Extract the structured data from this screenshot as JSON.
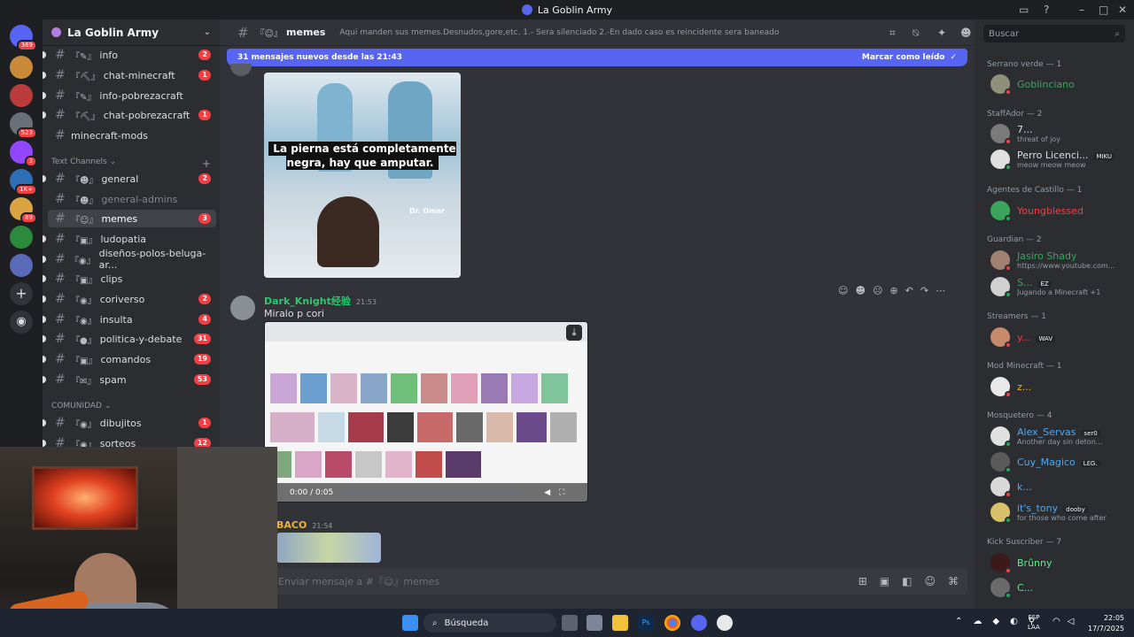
{
  "window": {
    "title": "La Goblin Army"
  },
  "servers": [
    {
      "badge": "369",
      "color": "#2b2d31"
    },
    {
      "badge": "",
      "color": "#c98b3a"
    },
    {
      "badge": "",
      "color": "#b93b3b"
    },
    {
      "badge": "523",
      "color": "#6b7078"
    },
    {
      "badge": "3",
      "color": "#9146ff"
    },
    {
      "badge": "1K+",
      "color": "#2f6fb5"
    },
    {
      "badge": "89",
      "color": "#d9a441"
    },
    {
      "badge": "",
      "color": "#2c8a3c"
    },
    {
      "badge": "",
      "color": "#5b6ab8"
    }
  ],
  "guild": {
    "name": "La Goblin Army"
  },
  "channels_top": [
    {
      "prefix": "『✎』",
      "name": "info",
      "count": "2"
    },
    {
      "prefix": "『⛏』",
      "name": "chat-minecraft",
      "count": "1"
    },
    {
      "prefix": "『✎』",
      "name": "info-pobrezacraft",
      "count": ""
    },
    {
      "prefix": "『⛏』",
      "name": "chat-pobrezacraft",
      "count": "1"
    },
    {
      "prefix": "",
      "name": "minecraft-mods",
      "count": ""
    }
  ],
  "category_text": "Text Channels",
  "channels_text": [
    {
      "prefix": "『☻』",
      "name": "general",
      "count": "2"
    },
    {
      "prefix": "『☻』",
      "name": "general-admins",
      "count": ""
    },
    {
      "prefix": "『☺』",
      "name": "memes",
      "count": "3"
    },
    {
      "prefix": "『▣』",
      "name": "ludopatia",
      "count": ""
    },
    {
      "prefix": "『◉』",
      "name": "diseños-polos-beluga-ar...",
      "count": ""
    },
    {
      "prefix": "『▣』",
      "name": "clips",
      "count": ""
    },
    {
      "prefix": "『◉』",
      "name": "coriverso",
      "count": "2"
    },
    {
      "prefix": "『◉』",
      "name": "insulta",
      "count": "4"
    },
    {
      "prefix": "『●』",
      "name": "politica-y-debate",
      "count": "31"
    },
    {
      "prefix": "『▣』",
      "name": "comandos",
      "count": "19"
    },
    {
      "prefix": "『✉』",
      "name": "spam",
      "count": "53"
    }
  ],
  "category_comunidad": "COMUNIDAD",
  "channels_comunidad": [
    {
      "prefix": "『◉』",
      "name": "dibujitos",
      "count": "1"
    },
    {
      "prefix": "『◉』",
      "name": "sorteos",
      "count": "12"
    }
  ],
  "header": {
    "channel_prefix": "『☺』",
    "channel_name": "memes",
    "topic": "Aqui manden sus memes.Desnudos,gore,etc. 1.- Sera silenciado 2.-En dado caso es reincidente sera baneado"
  },
  "banner": {
    "text": "31 mensajes nuevos desde las 21:43",
    "action": "Marcar como leído"
  },
  "messages": [
    {
      "image_caption": "La pierna está completamente negra, hay que amputar.",
      "image_watermark": "Dr. Omar"
    },
    {
      "author": "Dark_Knight经验",
      "time": "21:53",
      "text": "Miralo p cori",
      "video_time": "0:00 / 0:05",
      "author_color": "#2dc770"
    },
    {
      "author": "BACO",
      "time": "21:54",
      "author_color": "#f0b232"
    }
  ],
  "composer": {
    "placeholder": "Enviar mensaje a #『☺』memes"
  },
  "search": {
    "placeholder": "Buscar"
  },
  "member_groups": [
    {
      "role": "Serrano verde — 1",
      "members": [
        {
          "name": "Goblinciano",
          "color": "#3ba55c",
          "sub": "",
          "tag": ""
        }
      ]
    },
    {
      "role": "StaffAdor — 2",
      "members": [
        {
          "name": "7...",
          "color": "#dbdee1",
          "sub": "threat of joy",
          "tag": ""
        },
        {
          "name": "Perro Licenci...",
          "color": "#dbdee1",
          "sub": "meow meow meow",
          "tag": "MIKU"
        }
      ]
    },
    {
      "role": "Agentes de Castillo — 1",
      "members": [
        {
          "name": "Youngblessed",
          "color": "#f23f43",
          "sub": "",
          "tag": ""
        }
      ]
    },
    {
      "role": "Guardian — 2",
      "members": [
        {
          "name": "Jasiro Shady",
          "color": "#3ba55c",
          "sub": "https://www.youtube.com...",
          "tag": ""
        },
        {
          "name": "S...",
          "color": "#3ba55c",
          "sub": "Jugando a Minecraft +1",
          "tag": "EZ"
        }
      ]
    },
    {
      "role": "Streamers — 1",
      "members": [
        {
          "name": "y...",
          "color": "#f23f43",
          "sub": "",
          "tag": "WAV"
        }
      ]
    },
    {
      "role": "Mod Minecraft — 1",
      "members": [
        {
          "name": "z...",
          "color": "#f0b232",
          "sub": "",
          "tag": ""
        }
      ]
    },
    {
      "role": "Mosquetero — 4",
      "members": [
        {
          "name": "Alex_Servas",
          "color": "#4ea8f0",
          "sub": "Another day sin deton...",
          "tag": "ser0"
        },
        {
          "name": "Cuy_Magico",
          "color": "#4ea8f0",
          "sub": "",
          "tag": "LƐG."
        },
        {
          "name": "k...",
          "color": "#4ea8f0",
          "sub": "",
          "tag": ""
        },
        {
          "name": "it's_tony",
          "color": "#4ea8f0",
          "sub": "for those who come after",
          "tag": "dooby"
        }
      ]
    },
    {
      "role": "Kick Suscriber — 7",
      "members": [
        {
          "name": "Brûnny",
          "color": "#57f287",
          "sub": "",
          "tag": ""
        },
        {
          "name": "C...",
          "color": "#57f287",
          "sub": "",
          "tag": ""
        }
      ]
    }
  ],
  "taskbar": {
    "search": "Búsqueda",
    "time": "22:05",
    "date": "17/7/2025",
    "lang1": "ESP",
    "lang2": "LAA"
  }
}
